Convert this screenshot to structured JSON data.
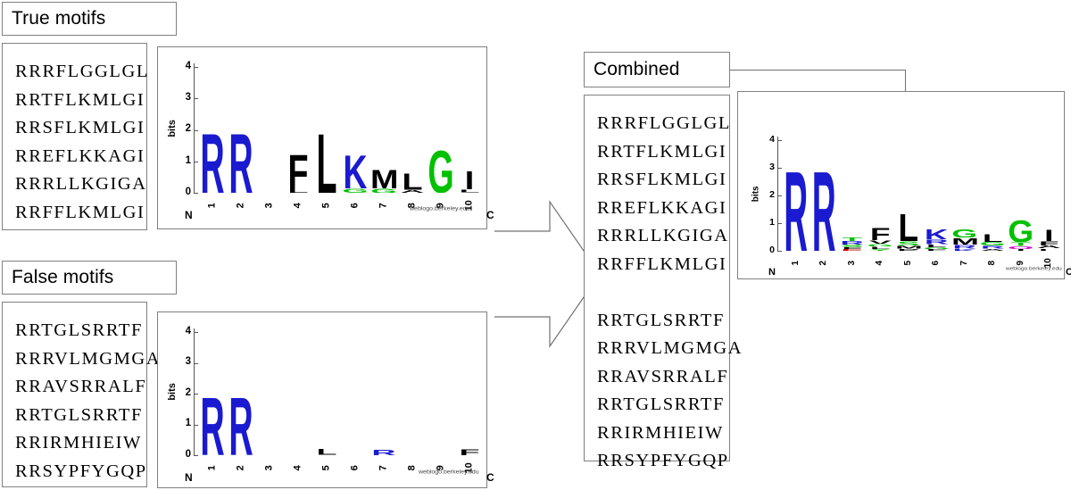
{
  "figure": {
    "type": "diagram",
    "description": "Three-panel diagram: true motifs and false motifs sequence sets with their sequence logos, merged by an arrow into a combined set with its sequence logo."
  },
  "panels": {
    "true": {
      "header": "True motifs",
      "sequences": [
        "RRRFLGGLGL",
        "RRTFLKMLGI",
        "RRSFLKMLGI",
        "RREFLKKAGI",
        "RRRLLKGIGA",
        "RRFFLKMLGI"
      ]
    },
    "false": {
      "header": "False motifs",
      "sequences": [
        "RRTGLSRRTF",
        "RRRVLMGMGA",
        "RRAVSRRALF",
        "RRTGLSRRTF",
        "RRIRMHIEIW",
        "RRSYPFYGQP"
      ]
    },
    "combined": {
      "header": "Combined",
      "sequences": [
        "RRRFLGGLGL",
        "RRTFLKMLGI",
        "RRSFLKMLGI",
        "RREFLKKAGI",
        "RRRLLKGIGA",
        "RRFFLKMLGI",
        "",
        "RRTGLSRRTF",
        "RRRVLMGMGA",
        "RRAVSRRALF",
        "RRTGLSRRTF",
        "RRIRMHIEIW",
        "RRSYPFYGQP"
      ]
    }
  },
  "colors": {
    "basic_blue": "#1a1ad0",
    "hydrophobic_black": "#000000",
    "neutral_green": "#00c000",
    "acidic_red": "#d00000",
    "polar_magenta": "#cc00cc",
    "border_gray": "#808080",
    "connector_gray": "#707070"
  },
  "chart_data": [
    {
      "id": "true-logo",
      "type": "bar",
      "title": "",
      "xlabel": "",
      "ylabel": "bits",
      "ylim": [
        0,
        4.35
      ],
      "yticks": [
        0,
        1,
        2,
        3,
        4
      ],
      "ytick_labels": [
        "0",
        "1",
        "2",
        "3",
        "4"
      ],
      "categories": [
        "1",
        "2",
        "3",
        "4",
        "5",
        "6",
        "7",
        "8",
        "9",
        "10"
      ],
      "terminus_left": "N",
      "terminus_right": "C",
      "watermark": "weblogo.berkeley.edu",
      "grid": false,
      "legend": "none",
      "stacks": [
        {
          "position": "1",
          "letters": [
            {
              "letter": "R",
              "bits": 2.0,
              "color": "#1a1ad0"
            }
          ]
        },
        {
          "position": "2",
          "letters": [
            {
              "letter": "R",
              "bits": 2.0,
              "color": "#1a1ad0"
            }
          ]
        },
        {
          "position": "3",
          "letters": [
            {
              "letter": "-",
              "bits": 0.04,
              "color": "#000000"
            }
          ]
        },
        {
          "position": "4",
          "letters": [
            {
              "letter": "F",
              "bits": 1.16,
              "color": "#000000"
            },
            {
              "letter": "L",
              "bits": 0.11,
              "color": "#000000"
            }
          ]
        },
        {
          "position": "5",
          "letters": [
            {
              "letter": "L",
              "bits": 2.0,
              "color": "#000000"
            }
          ]
        },
        {
          "position": "6",
          "letters": [
            {
              "letter": "K",
              "bits": 1.12,
              "color": "#1a1ad0"
            },
            {
              "letter": "G",
              "bits": 0.14,
              "color": "#00c000"
            }
          ]
        },
        {
          "position": "7",
          "letters": [
            {
              "letter": "M",
              "bits": 0.62,
              "color": "#000000"
            },
            {
              "letter": "G",
              "bits": 0.15,
              "color": "#00c000"
            }
          ]
        },
        {
          "position": "8",
          "letters": [
            {
              "letter": "L",
              "bits": 0.55,
              "color": "#000000"
            },
            {
              "letter": "A",
              "bits": 0.09,
              "color": "#000000"
            }
          ]
        },
        {
          "position": "9",
          "letters": [
            {
              "letter": "G",
              "bits": 1.42,
              "color": "#00c000"
            }
          ]
        },
        {
          "position": "10",
          "letters": [
            {
              "letter": "I",
              "bits": 0.6,
              "color": "#000000"
            },
            {
              "letter": "L",
              "bits": 0.1,
              "color": "#000000"
            }
          ]
        }
      ]
    },
    {
      "id": "false-logo",
      "type": "bar",
      "title": "",
      "xlabel": "",
      "ylabel": "bits",
      "ylim": [
        0,
        4.35
      ],
      "yticks": [
        0,
        1,
        2,
        3,
        4
      ],
      "ytick_labels": [
        "0",
        "1",
        "2",
        "3",
        "4"
      ],
      "categories": [
        "1",
        "2",
        "3",
        "4",
        "5",
        "6",
        "7",
        "8",
        "9",
        "10"
      ],
      "terminus_left": "N",
      "terminus_right": "C",
      "watermark": "weblogo.berkeley.edu",
      "grid": false,
      "legend": "none",
      "stacks": [
        {
          "position": "1",
          "letters": [
            {
              "letter": "R",
              "bits": 2.0,
              "color": "#1a1ad0"
            }
          ]
        },
        {
          "position": "2",
          "letters": [
            {
              "letter": "R",
              "bits": 2.0,
              "color": "#1a1ad0"
            }
          ]
        },
        {
          "position": "3",
          "letters": []
        },
        {
          "position": "4",
          "letters": []
        },
        {
          "position": "5",
          "letters": [
            {
              "letter": "L",
              "bits": 0.19,
              "color": "#000000"
            }
          ]
        },
        {
          "position": "6",
          "letters": []
        },
        {
          "position": "7",
          "letters": [
            {
              "letter": "R",
              "bits": 0.17,
              "color": "#1a1ad0"
            }
          ]
        },
        {
          "position": "8",
          "letters": []
        },
        {
          "position": "9",
          "letters": []
        },
        {
          "position": "10",
          "letters": [
            {
              "letter": "F",
              "bits": 0.2,
              "color": "#000000"
            }
          ]
        }
      ]
    },
    {
      "id": "combined-logo",
      "type": "bar",
      "title": "",
      "xlabel": "",
      "ylabel": "bits",
      "ylim": [
        0,
        4.35
      ],
      "yticks": [
        0,
        1,
        2,
        3,
        4
      ],
      "ytick_labels": [
        "0",
        "1",
        "2",
        "3",
        "4"
      ],
      "categories": [
        "1",
        "2",
        "3",
        "4",
        "5",
        "6",
        "7",
        "8",
        "9",
        "10"
      ],
      "terminus_left": "N",
      "terminus_right": "C",
      "watermark": "weblogo.berkeley.edu",
      "grid": false,
      "legend": "none",
      "stacks": [
        {
          "position": "1",
          "letters": [
            {
              "letter": "R",
              "bits": 3.1,
              "color": "#1a1ad0"
            }
          ]
        },
        {
          "position": "2",
          "letters": [
            {
              "letter": "R",
              "bits": 3.1,
              "color": "#1a1ad0"
            }
          ]
        },
        {
          "position": "3",
          "letters": [
            {
              "letter": "T",
              "bits": 0.13,
              "color": "#00c000"
            },
            {
              "letter": "R",
              "bits": 0.12,
              "color": "#1a1ad0"
            },
            {
              "letter": "S",
              "bits": 0.1,
              "color": "#00c000"
            },
            {
              "letter": "F",
              "bits": 0.08,
              "color": "#000000"
            },
            {
              "letter": "E",
              "bits": 0.06,
              "color": "#d00000"
            }
          ]
        },
        {
          "position": "4",
          "letters": [
            {
              "letter": "F",
              "bits": 0.47,
              "color": "#000000"
            },
            {
              "letter": "V",
              "bits": 0.14,
              "color": "#000000"
            },
            {
              "letter": "G",
              "bits": 0.11,
              "color": "#00c000"
            },
            {
              "letter": "L",
              "bits": 0.09,
              "color": "#000000"
            },
            {
              "letter": "Y",
              "bits": 0.06,
              "color": "#00c000"
            }
          ]
        },
        {
          "position": "5",
          "letters": [
            {
              "letter": "L",
              "bits": 1.05,
              "color": "#000000"
            },
            {
              "letter": "S",
              "bits": 0.17,
              "color": "#00c000"
            },
            {
              "letter": "M",
              "bits": 0.11,
              "color": "#000000"
            },
            {
              "letter": "P",
              "bits": 0.08,
              "color": "#000000"
            }
          ]
        },
        {
          "position": "6",
          "letters": [
            {
              "letter": "K",
              "bits": 0.41,
              "color": "#1a1ad0"
            },
            {
              "letter": "R",
              "bits": 0.17,
              "color": "#1a1ad0"
            },
            {
              "letter": "L",
              "bits": 0.1,
              "color": "#000000"
            },
            {
              "letter": "G",
              "bits": 0.08,
              "color": "#00c000"
            },
            {
              "letter": "F",
              "bits": 0.06,
              "color": "#000000"
            }
          ]
        },
        {
          "position": "7",
          "letters": [
            {
              "letter": "G",
              "bits": 0.33,
              "color": "#00c000"
            },
            {
              "letter": "M",
              "bits": 0.25,
              "color": "#000000"
            },
            {
              "letter": "R",
              "bits": 0.14,
              "color": "#1a1ad0"
            },
            {
              "letter": "K",
              "bits": 0.08,
              "color": "#1a1ad0"
            }
          ]
        },
        {
          "position": "8",
          "letters": [
            {
              "letter": "L",
              "bits": 0.3,
              "color": "#000000"
            },
            {
              "letter": "G",
              "bits": 0.13,
              "color": "#00c000"
            },
            {
              "letter": "R",
              "bits": 0.11,
              "color": "#1a1ad0"
            },
            {
              "letter": "A",
              "bits": 0.07,
              "color": "#000000"
            }
          ]
        },
        {
          "position": "9",
          "letters": [
            {
              "letter": "G",
              "bits": 0.85,
              "color": "#00c000"
            },
            {
              "letter": "T",
              "bits": 0.14,
              "color": "#00c000"
            },
            {
              "letter": "Q",
              "bits": 0.1,
              "color": "#cc00cc"
            },
            {
              "letter": "I",
              "bits": 0.07,
              "color": "#000000"
            }
          ]
        },
        {
          "position": "10",
          "letters": [
            {
              "letter": "I",
              "bits": 0.43,
              "color": "#000000"
            },
            {
              "letter": "F",
              "bits": 0.17,
              "color": "#000000"
            },
            {
              "letter": "A",
              "bits": 0.1,
              "color": "#000000"
            },
            {
              "letter": "L",
              "bits": 0.08,
              "color": "#000000"
            }
          ]
        }
      ]
    }
  ]
}
